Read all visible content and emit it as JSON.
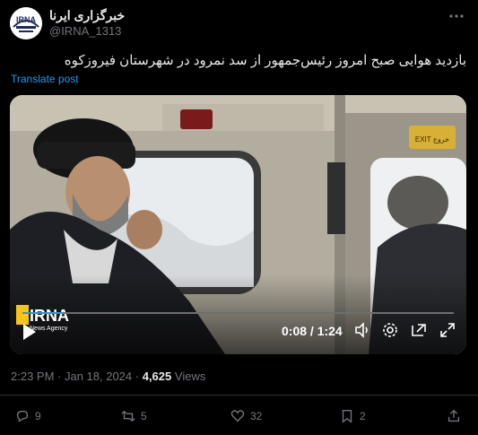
{
  "author": {
    "name": "خبرگزاری ایرنا",
    "handle": "@IRNA_1313",
    "avatar_text": "IRNA"
  },
  "post": {
    "text": "بازدید هوایی صبح امروز رئیس‌جمهور از سد نمرود در شهرستان فیروزکوه",
    "translate_label": "Translate post",
    "timestamp": "2:23 PM · Jan 18, 2024 ·",
    "views_count": "4,625",
    "views_label": "Views"
  },
  "video": {
    "watermark_title": "IRNA",
    "watermark_sub": "News Agency",
    "sign_text": "EXIT خروج",
    "time_display": "0:08 / 1:24",
    "progress": 0.095
  },
  "actions": {
    "replies": "9",
    "reposts": "5",
    "likes": "32",
    "bookmarks": "2"
  }
}
